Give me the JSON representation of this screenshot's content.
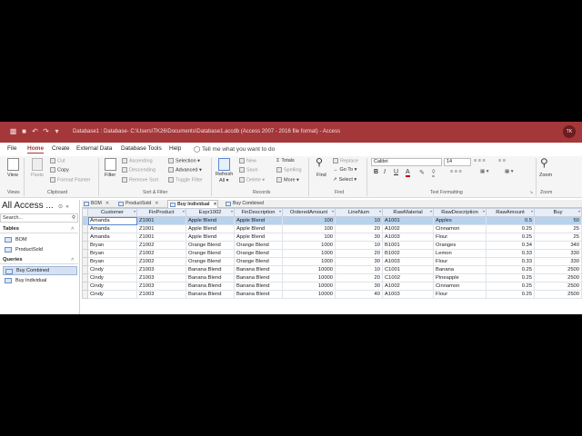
{
  "titlebar": {
    "title": "Database1 : Database- C:\\Users\\TK26\\Documents\\Database1.accdb (Access 2007 - 2016 file format)  -  Access",
    "user_initials": "TK"
  },
  "menu": {
    "tabs": [
      "File",
      "Home",
      "Create",
      "External Data",
      "Database Tools",
      "Help"
    ],
    "tell_me": "Tell me what you want to do"
  },
  "ribbon": {
    "views": {
      "view_label": "View",
      "group": "Views"
    },
    "clipboard": {
      "paste": "Paste",
      "cut": "Cut",
      "copy": "Copy",
      "format_painter": "Format Painter",
      "group": "Clipboard"
    },
    "sort_filter": {
      "filter": "Filter",
      "ascending": "Ascending",
      "descending": "Descending",
      "remove_sort": "Remove Sort",
      "selection": "Selection",
      "advanced": "Advanced",
      "toggle_filter": "Toggle Filter",
      "group": "Sort & Filter"
    },
    "records": {
      "refresh_all": "Refresh",
      "refresh_all2": "All",
      "new": "New",
      "save": "Save",
      "delete": "Delete",
      "totals": "Totals",
      "spelling": "Spelling",
      "more": "More",
      "group": "Records"
    },
    "find": {
      "find": "Find",
      "replace": "Replace",
      "go_to": "Go To",
      "select": "Select",
      "group": "Find"
    },
    "text_formatting": {
      "font": "Calibri",
      "size": "14",
      "bold": "B",
      "italic": "I",
      "underline": "U",
      "group": "Text Formatting"
    },
    "window": {
      "zoom": "Zoom",
      "group": "Zoom"
    }
  },
  "nav": {
    "title": "All Access ...",
    "search_placeholder": "Search...",
    "sections": [
      {
        "label": "Tables",
        "items": [
          "BOM",
          "ProductSold"
        ]
      },
      {
        "label": "Queries",
        "items": [
          "Buy Combined",
          "Buy Individual"
        ]
      }
    ]
  },
  "doctabs": [
    "BOM",
    "ProductSold",
    "Buy Individual",
    "Buy Combined"
  ],
  "grid": {
    "columns": [
      "Customer",
      "FinProduct",
      "Expr1002",
      "FinDescription",
      "OrderedAmount",
      "LineNum",
      "RawMaterial",
      "RawDescription",
      "RawAmount",
      "Buy"
    ],
    "rows": [
      [
        "Amanda",
        "Z1001",
        "Apple Blend",
        "Apple Blend",
        "100",
        "10",
        "A1001",
        "Apples",
        "0.5",
        "50"
      ],
      [
        "Amanda",
        "Z1001",
        "Apple Blend",
        "Apple Blend",
        "100",
        "20",
        "A1002",
        "Cinnamon",
        "0.25",
        "25"
      ],
      [
        "Amanda",
        "Z1001",
        "Apple Blend",
        "Apple Blend",
        "100",
        "30",
        "A1003",
        "Flour",
        "0.25",
        "25"
      ],
      [
        "Bryan",
        "Z1002",
        "Orange Blend",
        "Orange Blend",
        "1000",
        "10",
        "B1001",
        "Oranges",
        "0.34",
        "340"
      ],
      [
        "Bryan",
        "Z1002",
        "Orange Blend",
        "Orange Blend",
        "1000",
        "20",
        "B1002",
        "Lemon",
        "0.33",
        "330"
      ],
      [
        "Bryan",
        "Z1002",
        "Orange Blend",
        "Orange Blend",
        "1000",
        "30",
        "A1003",
        "Flour",
        "0.33",
        "330"
      ],
      [
        "Cindy",
        "Z1003",
        "Banana Blend",
        "Banana Blend",
        "10000",
        "10",
        "C1001",
        "Banana",
        "0.25",
        "2500"
      ],
      [
        "Cindy",
        "Z1003",
        "Banana Blend",
        "Banana Blend",
        "10000",
        "20",
        "C1002",
        "Pineapple",
        "0.25",
        "2500"
      ],
      [
        "Cindy",
        "Z1003",
        "Banana Blend",
        "Banana Blend",
        "10000",
        "30",
        "A1002",
        "Cinnamon",
        "0.25",
        "2500"
      ],
      [
        "Cindy",
        "Z1003",
        "Banana Blend",
        "Banana Blend",
        "10000",
        "40",
        "A1003",
        "Flour",
        "0.25",
        "2500"
      ]
    ]
  },
  "colors": {
    "accent": "#a4373a",
    "header_bg": "#e8eef8",
    "selected_row": "#b7d3ee"
  }
}
